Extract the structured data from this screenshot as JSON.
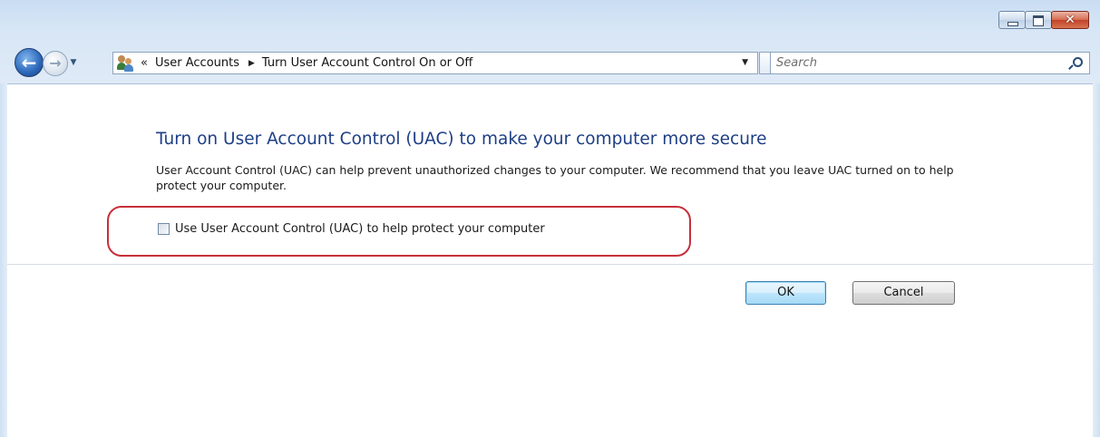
{
  "window": {
    "controls": {
      "minimize_icon": "minimize-icon",
      "maximize_icon": "maximize-icon",
      "close_icon": "close-icon",
      "close_glyph": "✕"
    }
  },
  "navigation": {
    "back_glyph": "←",
    "forward_glyph": "→",
    "history_glyph": "▼"
  },
  "address_bar": {
    "icon": "user-accounts-icon",
    "overflow_glyph": "«",
    "breadcrumbs": [
      "User Accounts",
      "Turn User Account Control On or Off"
    ],
    "separator_glyph": "▶",
    "dropdown_glyph": "▼",
    "refresh_glyph": "↔"
  },
  "search": {
    "placeholder": "Search",
    "icon": "search-icon"
  },
  "main": {
    "heading": "Turn on User Account Control (UAC) to make your computer more secure",
    "description": "User Account Control (UAC) can help prevent unauthorized changes to your computer.  We recommend that you leave UAC turned on to help protect your computer.",
    "uac_option": {
      "label": "Use User Account Control (UAC) to help protect your computer",
      "checked": false
    },
    "highlight_color": "#c6303a"
  },
  "buttons": {
    "ok": "OK",
    "cancel": "Cancel"
  },
  "colors": {
    "heading": "#1e3f86",
    "frame": "#c9ddf2",
    "ok_accent": "#3c7fb1"
  }
}
